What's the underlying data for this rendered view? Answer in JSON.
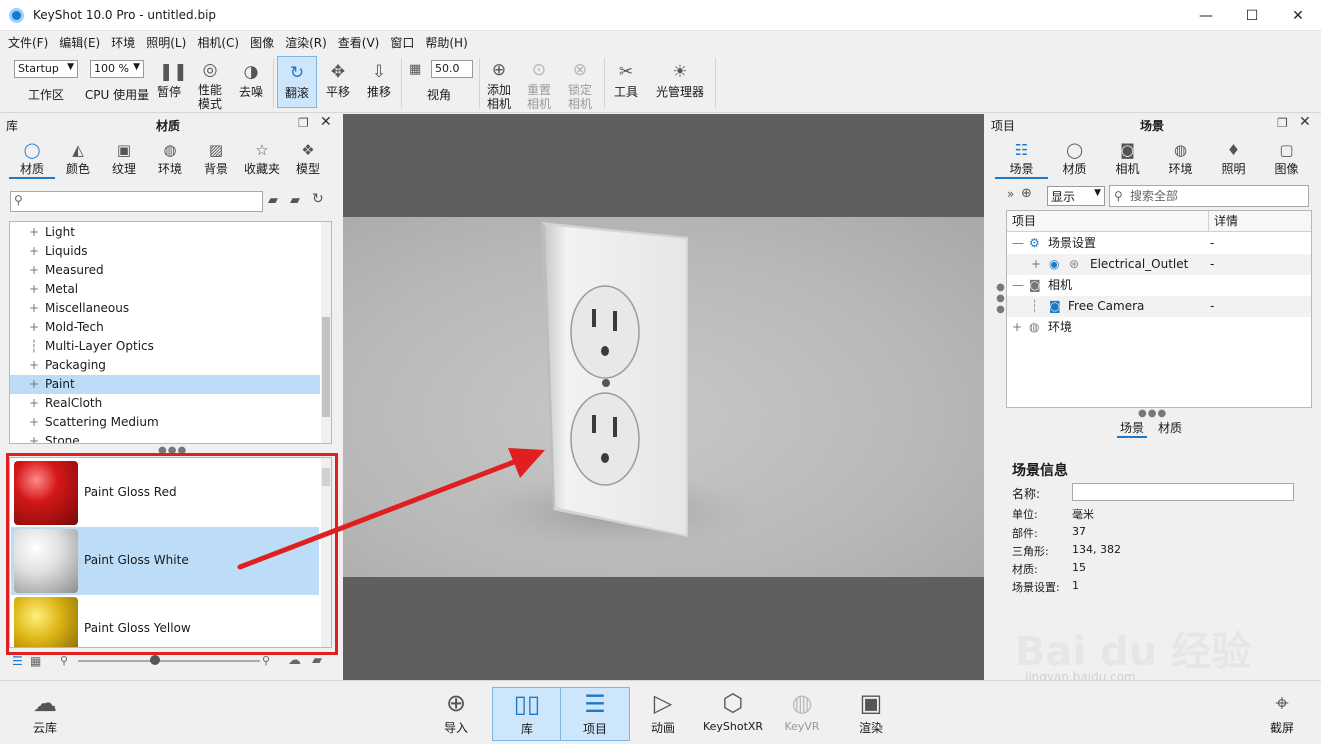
{
  "window": {
    "title": "KeyShot 10.0 Pro  - untitled.bip",
    "min": "—",
    "max": "☐",
    "close": "✕"
  },
  "menu": [
    "文件(F)",
    "编辑(E)",
    "环境",
    "照明(L)",
    "相机(C)",
    "图像",
    "渲染(R)",
    "查看(V)",
    "窗口",
    "帮助(H)"
  ],
  "toolbar": {
    "workspace_select": "Startup",
    "workspace_label": "工作区",
    "cpu_select": "100 %",
    "cpu_label": "CPU 使用量",
    "pause": "暂停",
    "perf_mode": "性能\n模式",
    "denoise": "去噪",
    "tumble": "翻滚",
    "pan": "平移",
    "dolly": "推移",
    "fov_value": "50.0",
    "fov_label": "视角",
    "add_camera": "添加\n相机",
    "reset_camera": "重置\n相机",
    "lock_camera": "锁定\n相机",
    "tools": "工具",
    "light_manager": "光管理器"
  },
  "library": {
    "header_left": "库",
    "header_title": "材质",
    "tabs": [
      "材质",
      "颜色",
      "纹理",
      "环境",
      "背景",
      "收藏夹",
      "模型"
    ],
    "search_placeholder": "",
    "tree": [
      "Light",
      "Liquids",
      "Measured",
      "Metal",
      "Miscellaneous",
      "Mold-Tech",
      "Multi-Layer Optics",
      "Packaging",
      "Paint",
      "RealCloth",
      "Scattering Medium",
      "Stone"
    ],
    "selected": "Paint",
    "thumbnails": [
      {
        "name": "Paint Gloss Red",
        "color": "#c81212"
      },
      {
        "name": "Paint Gloss White",
        "color": "#e6e6e6"
      },
      {
        "name": "Paint Gloss Yellow",
        "color": "#d8b410"
      }
    ]
  },
  "project": {
    "header_left": "项目",
    "header_title": "场景",
    "tabs": [
      "场景",
      "材质",
      "相机",
      "环境",
      "照明",
      "图像"
    ],
    "display_select": "显示",
    "search_placeholder": "搜索全部",
    "columns": [
      "项目",
      "详情"
    ],
    "rows": [
      {
        "label": "场景设置",
        "detail": "-"
      },
      {
        "label": "Electrical_Outlet",
        "detail": "-"
      },
      {
        "label": "相机",
        "detail": ""
      },
      {
        "label": "Free Camera",
        "detail": "-"
      },
      {
        "label": "环境",
        "detail": ""
      }
    ],
    "subtabs": [
      "场景",
      "材质"
    ],
    "info_title": "场景信息",
    "info": [
      {
        "k": "名称:",
        "v": ""
      },
      {
        "k": "单位:",
        "v": "毫米"
      },
      {
        "k": "部件:",
        "v": "37"
      },
      {
        "k": "三角形:",
        "v": "134, 382"
      },
      {
        "k": "材质:",
        "v": "15"
      },
      {
        "k": "场景设置:",
        "v": "1"
      }
    ]
  },
  "bottom": {
    "cloud": "云库",
    "import": "导入",
    "library": "库",
    "project": "项目",
    "animation": "动画",
    "keyshotxr": "KeyShotXR",
    "keyvr": "KeyVR",
    "render": "渲染",
    "screenshot": "截屏"
  },
  "watermark": {
    "brand": "Bai du 经验",
    "url": "jingyan.baidu.com"
  },
  "colors": {
    "accent": "#1e78c8",
    "highlight": "#bcdcf7",
    "arrow": "#e02020"
  }
}
